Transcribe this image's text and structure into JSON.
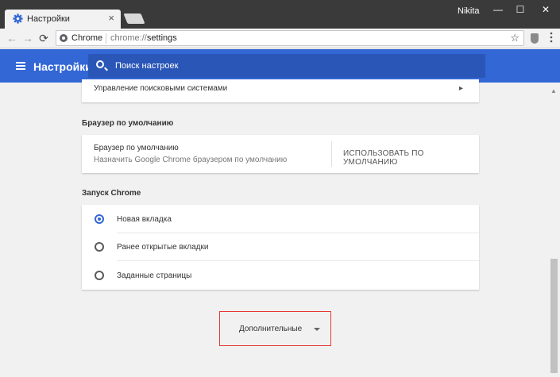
{
  "window": {
    "tab_title": "Настройки",
    "tab_close": "×",
    "user_name": "Nikita",
    "minimize": "—",
    "maximize": "☐",
    "close": "✕"
  },
  "toolbar": {
    "back": "←",
    "forward": "→",
    "reload": "⟳",
    "site_label": "Chrome",
    "url_scheme": "chrome://",
    "url_path": "settings",
    "star": "☆",
    "menu": "⋮"
  },
  "header": {
    "title": "Настройки",
    "search_placeholder": "Поиск настроек"
  },
  "search_engines": {
    "manage_label": "Управление поисковыми системами",
    "chevron": "▸"
  },
  "default_browser": {
    "section_title": "Браузер по умолчанию",
    "row_title": "Браузер по умолчанию",
    "row_subtitle": "Назначить Google Chrome браузером по умолчанию",
    "button_label": "ИСПОЛЬЗОВАТЬ ПО УМОЛЧАНИЮ"
  },
  "startup": {
    "section_title": "Запуск Chrome",
    "options": [
      {
        "label": "Новая вкладка",
        "checked": true
      },
      {
        "label": "Ранее открытые вкладки",
        "checked": false
      },
      {
        "label": "Заданные страницы",
        "checked": false
      }
    ]
  },
  "advanced": {
    "label": "Дополнительные"
  },
  "colors": {
    "accent": "#3367d6",
    "titlebar": "#3a3a3a",
    "highlight_border": "#e53935"
  }
}
